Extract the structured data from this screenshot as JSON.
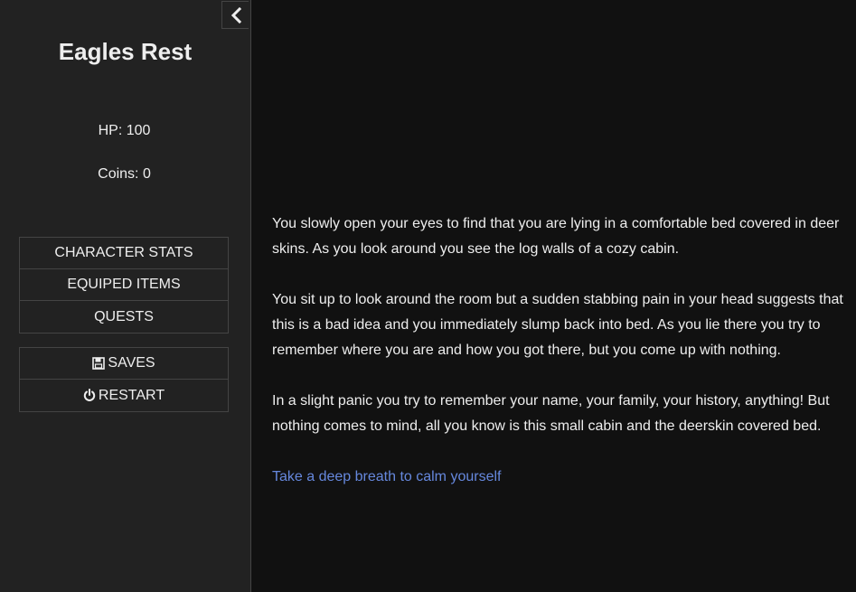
{
  "sidebar": {
    "story_title": "Eagles Rest",
    "hp_text": "HP: 100",
    "coins_text": "Coins: 0",
    "menu_main": [
      {
        "label": "CHARACTER STATS"
      },
      {
        "label": "EQUIPED ITEMS"
      },
      {
        "label": "QUESTS"
      }
    ],
    "menu_system": [
      {
        "label": "SAVES",
        "icon": "save-icon"
      },
      {
        "label": "RESTART",
        "icon": "power-icon"
      }
    ]
  },
  "passage": {
    "paragraphs": [
      "You slowly open your eyes to find that you are lying in a comfortable bed covered in deer skins. As you look around you see the log walls of a cozy cabin.",
      "You sit up to look around the room but a sudden stabbing pain in your head suggests that this is a bad idea and you immediately slump back into bed. As you lie there you try to remember where you are and how you got there, but you come up with nothing.",
      "In a slight panic you try to remember your name, your family, your history, anything! But nothing comes to mind, all you know is this small cabin and the deerskin covered bed."
    ],
    "link": "Take a deep breath to calm yourself"
  },
  "colors": {
    "background": "#111111",
    "sidebar": "#222222",
    "text": "#eeeeee",
    "link": "#6688dd",
    "border": "#444444"
  }
}
